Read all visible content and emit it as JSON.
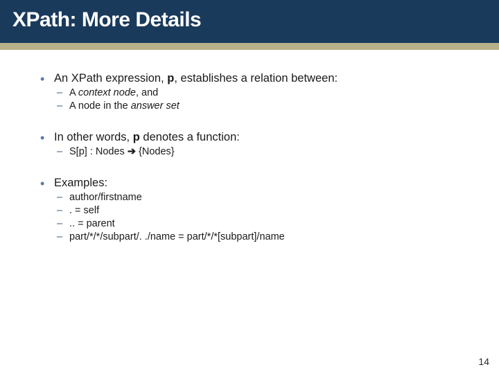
{
  "title": "XPath: More Details",
  "b1": {
    "pre": "An XPath expression, ",
    "p": "p",
    "post": ", establishes a relation between:"
  },
  "b1s1": {
    "pre": "A ",
    "it": "context node",
    "post": ", and"
  },
  "b1s2": {
    "pre": "A node in the ",
    "it": "answer set",
    "post": ""
  },
  "b2": {
    "pre": "In other words, ",
    "p": "p",
    "post": " denotes a function:"
  },
  "b2s1": {
    "pre": "S[",
    "p": "p",
    "mid": "] : Nodes ",
    "arrow": "➔",
    "post": " {Nodes}"
  },
  "b3": "Examples:",
  "b3s1": "author/firstname",
  "b3s2": ".   = self",
  "b3s3": "..  = parent",
  "b3s4": "part/*/*/subpart/. ./name = part/*/*[subpart]/name",
  "page": "14"
}
